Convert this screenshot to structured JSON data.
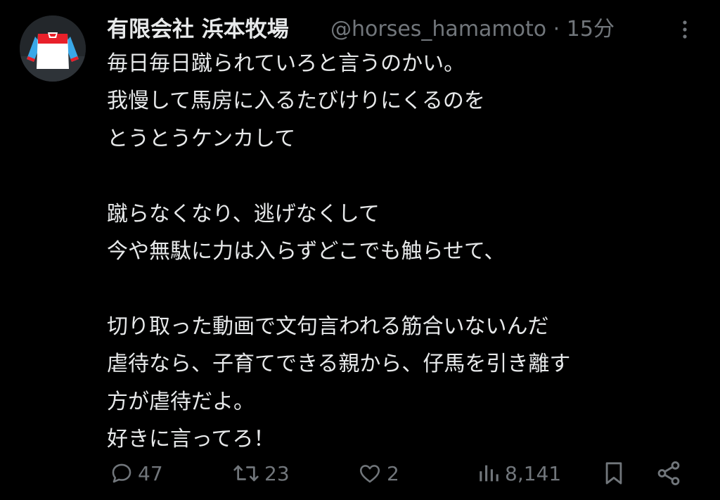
{
  "tweet": {
    "display_name": "有限会社 浜本牧場",
    "handle": "@horses_hamamoto",
    "timestamp": "15分",
    "separator": "·",
    "lines": [
      "毎日毎日蹴られていろと言うのかい。",
      "我慢して馬房に入るたびけりにくるのを",
      "とうとうケンカして",
      "",
      "蹴らなくなり、逃げなくして",
      "今や無駄に力は入らずどこでも触らせて、",
      "",
      "切り取った動画で文句言われる筋合いないんだ",
      "虐待なら、子育てできる親から、仔馬を引き離す",
      "方が虐待だよ。",
      "好きに言ってろ！"
    ]
  },
  "actions": {
    "replies": "47",
    "reposts": "23",
    "likes": "2",
    "views": "8,141"
  },
  "icons": {
    "avatar": "jockey-silks-icon",
    "more": "more-vertical-icon",
    "reply": "reply-icon",
    "repost": "repost-icon",
    "like": "heart-icon",
    "views": "views-icon",
    "bookmark": "bookmark-icon",
    "share": "share-icon"
  },
  "colors": {
    "background": "#000000",
    "text_primary": "#e7e9ea",
    "text_secondary": "#71767b",
    "silks_red": "#e8202a",
    "silks_blue": "#3aa8e8"
  }
}
